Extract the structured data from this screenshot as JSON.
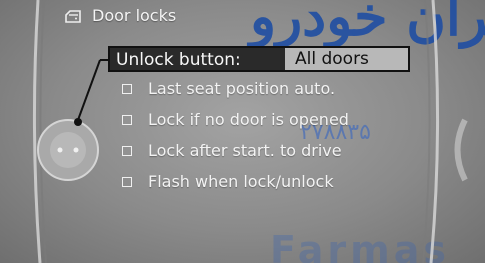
{
  "header": {
    "title": "Door locks",
    "icon": "car-door-icon"
  },
  "menu": {
    "selected": {
      "label": "Unlock button:",
      "value": "All doors"
    },
    "options": [
      {
        "label": "Last seat position auto.",
        "checked": false
      },
      {
        "label": "Lock if no door is opened",
        "checked": false
      },
      {
        "label": "Lock after start. to drive",
        "checked": false
      },
      {
        "label": "Flash when lock/unlock",
        "checked": false
      }
    ]
  },
  "watermarks": {
    "top": "ﺍﻳﺮﺍﻥ ﺧﻮﺩﺭﻭ",
    "mid": "۲۷۸۸۳۵",
    "bottom": "Farmas"
  }
}
